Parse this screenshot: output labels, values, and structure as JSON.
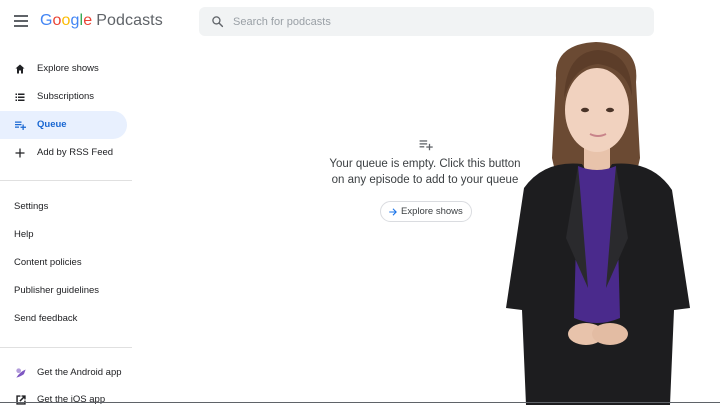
{
  "app": {
    "logo_letters": [
      "G",
      "o",
      "o",
      "g",
      "l",
      "e"
    ],
    "product": "Podcasts"
  },
  "search": {
    "placeholder": "Search for podcasts",
    "value": ""
  },
  "sidebar": {
    "nav": [
      {
        "label": "Explore shows",
        "icon": "home-icon",
        "active": false
      },
      {
        "label": "Subscriptions",
        "icon": "list-icon",
        "active": false
      },
      {
        "label": "Queue",
        "icon": "queue-icon",
        "active": true
      },
      {
        "label": "Add by RSS Feed",
        "icon": "plus-icon",
        "active": false
      }
    ],
    "links": [
      "Settings",
      "Help",
      "Content policies",
      "Publisher guidelines",
      "Send feedback"
    ],
    "apps": [
      {
        "label": "Get the Android app",
        "icon": "android-app-icon"
      },
      {
        "label": "Get the iOS app",
        "icon": "external-link-icon"
      }
    ]
  },
  "main": {
    "empty_icon": "playlist-add-icon",
    "empty_message_line1": "Your queue is empty. Click this button",
    "empty_message_line2": "on any episode to add to your queue",
    "explore_button": "Explore shows"
  },
  "colors": {
    "accent": "#1967d2",
    "active_bg": "#e8f0fe",
    "search_bg": "#f1f3f4"
  }
}
